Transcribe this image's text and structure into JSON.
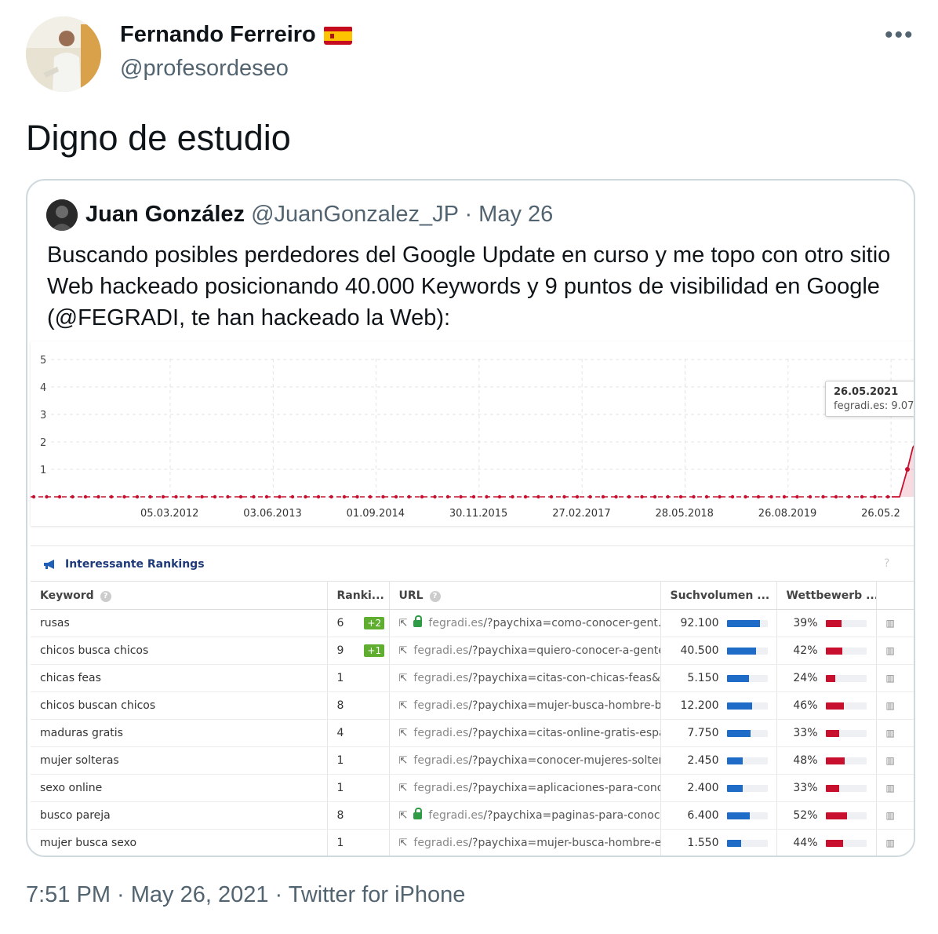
{
  "tweet": {
    "author_name": "Fernando Ferreiro",
    "author_handle": "@profesordeseo",
    "text": "Digno de estudio",
    "footer": "7:51 PM · May 26, 2021 · Twitter for iPhone",
    "more_icon": "more-horizontal-icon",
    "flag_icon": "spain-flag-icon"
  },
  "quoted": {
    "name": "Juan González",
    "handle": "@JuanGonzalez_JP",
    "date": "· May 26",
    "text": "Buscando posibles perdedores del Google Update en curso y me topo con otro sitio Web hackeado posicionando 40.000 Keywords y 9 puntos de visibilidad en Google (@FEGRADI, te han hackeado la Web):"
  },
  "chart_data": {
    "type": "line",
    "y_ticks": [
      "5",
      "4",
      "3",
      "2",
      "1"
    ],
    "x_ticks": [
      "05.03.2012",
      "03.06.2013",
      "01.09.2014",
      "30.11.2015",
      "27.02.2017",
      "28.05.2018",
      "26.08.2019",
      "26.05.2"
    ],
    "ylim": [
      0,
      5
    ],
    "grid": true,
    "series": [
      {
        "name": "fegradi.es",
        "color": "#c8102e",
        "flat_value": 0,
        "end_values": [
          0,
          0,
          1,
          1.8,
          2
        ]
      }
    ],
    "tooltip": {
      "date": "26.05.2021",
      "label": "fegradi.es: 9.07"
    }
  },
  "rankings": {
    "title": "Interessante Rankings",
    "help": "?",
    "columns": {
      "keyword": "Keyword",
      "ranking": "Ranki...",
      "url": "URL",
      "volume": "Suchvolumen ...",
      "competition": "Wettbewerb ..."
    },
    "rows": [
      {
        "keyword": "rusas",
        "rank": "6",
        "change": "+2",
        "secure": true,
        "host": "fegradi.es",
        "path": "/?paychixa=como-conocer-gent...",
        "volume": "92.100",
        "vol_frac": 0.82,
        "comp": "39%",
        "comp_frac": 0.39
      },
      {
        "keyword": "chicos busca chicos",
        "rank": "9",
        "change": "+1",
        "secure": false,
        "host": "fegradi.es",
        "path": "/?paychixa=quiero-conocer-a-gente...",
        "volume": "40.500",
        "vol_frac": 0.72,
        "comp": "42%",
        "comp_frac": 0.42
      },
      {
        "keyword": "chicas feas",
        "rank": "1",
        "change": "",
        "secure": false,
        "host": "fegradi.es",
        "path": "/?paychixa=citas-con-chicas-feas&f...",
        "volume": "5.150",
        "vol_frac": 0.55,
        "comp": "24%",
        "comp_frac": 0.24
      },
      {
        "keyword": "chicos buscan chicos",
        "rank": "8",
        "change": "",
        "secure": false,
        "host": "fegradi.es",
        "path": "/?paychixa=mujer-busca-hombre-b...",
        "volume": "12.200",
        "vol_frac": 0.62,
        "comp": "46%",
        "comp_frac": 0.46
      },
      {
        "keyword": "maduras gratis",
        "rank": "4",
        "change": "",
        "secure": false,
        "host": "fegradi.es",
        "path": "/?paychixa=citas-online-gratis-espa...",
        "volume": "7.750",
        "vol_frac": 0.58,
        "comp": "33%",
        "comp_frac": 0.33
      },
      {
        "keyword": "mujer solteras",
        "rank": "1",
        "change": "",
        "secure": false,
        "host": "fegradi.es",
        "path": "/?paychixa=conocer-mujeres-solter...",
        "volume": "2.450",
        "vol_frac": 0.4,
        "comp": "48%",
        "comp_frac": 0.48
      },
      {
        "keyword": "sexo online",
        "rank": "1",
        "change": "",
        "secure": false,
        "host": "fegradi.es",
        "path": "/?paychixa=aplicaciones-para-cono...",
        "volume": "2.400",
        "vol_frac": 0.4,
        "comp": "33%",
        "comp_frac": 0.33
      },
      {
        "keyword": "busco pareja",
        "rank": "8",
        "change": "",
        "secure": true,
        "host": "fegradi.es",
        "path": "/?paychixa=paginas-para-conoc...",
        "volume": "6.400",
        "vol_frac": 0.56,
        "comp": "52%",
        "comp_frac": 0.52
      },
      {
        "keyword": "mujer busca sexo",
        "rank": "1",
        "change": "",
        "secure": false,
        "host": "fegradi.es",
        "path": "/?paychixa=mujer-busca-hombre-e...",
        "volume": "1.550",
        "vol_frac": 0.36,
        "comp": "44%",
        "comp_frac": 0.44
      }
    ]
  }
}
